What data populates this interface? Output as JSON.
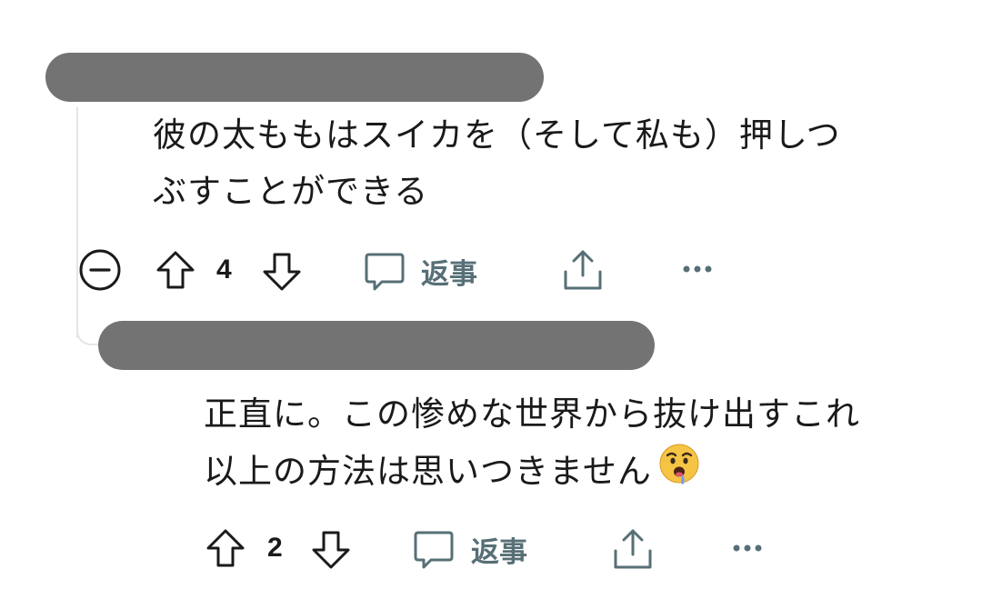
{
  "comment1": {
    "username_redacted": true,
    "body_line1": "彼の太ももはスイカを（そして私も）押しつ",
    "body_line2": "ぶすことができる",
    "votes": "4",
    "reply_label": "返事"
  },
  "comment2": {
    "username_redacted": true,
    "body_line1": "正直に。この惨めな世界から抜け出すこれ",
    "body_line2": "以上の方法は思いつきません",
    "emoji": "drooling-face",
    "votes": "2",
    "reply_label": "返事"
  },
  "colors": {
    "redaction": "#737373",
    "icon": "#1a1a1b",
    "muted_icon": "#576f76",
    "thread_line": "#e5e5e5"
  }
}
